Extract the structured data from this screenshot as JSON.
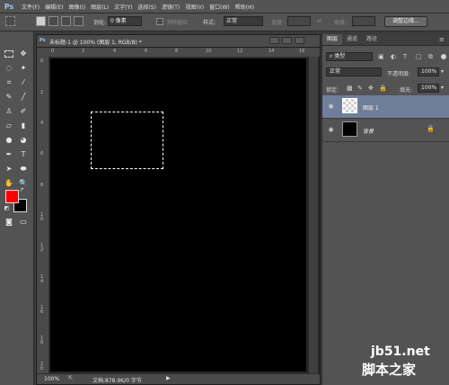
{
  "app": {
    "logo": "Ps"
  },
  "menu": [
    "文件(F)",
    "编辑(E)",
    "图像(I)",
    "图层(L)",
    "文字(Y)",
    "选择(S)",
    "滤镜(T)",
    "视图(V)",
    "窗口(W)",
    "帮助(H)"
  ],
  "options": {
    "feather_label": "羽化:",
    "feather_value": "0 像素",
    "antialias_label": "消除锯齿",
    "style_label": "样式:",
    "style_value": "正常",
    "width_label": "宽度:",
    "height_label": "高度:",
    "refine_edge_button": "调整边缘..."
  },
  "document": {
    "title": "未标题-1 @ 100% (图层 1, RGB/8) *",
    "ruler_top": [
      "0",
      "2",
      "4",
      "6",
      "8",
      "10",
      "12",
      "14",
      "16"
    ],
    "ruler_left": [
      "0",
      "2",
      "4",
      "6",
      "8",
      "1\n0",
      "1\n2",
      "1\n4",
      "1\n6",
      "1\n8",
      "2\n0"
    ],
    "zoom": "100%",
    "status_text": "文档:878.9K/0 字节"
  },
  "layers_panel": {
    "tabs": [
      "图层",
      "通道",
      "路径"
    ],
    "filter_label": "类型",
    "blend_mode": "正常",
    "opacity_label": "不透明度:",
    "opacity_value": "100%",
    "lock_label": "锁定:",
    "fill_label": "填充:",
    "fill_value": "100%",
    "layers": [
      {
        "name": "图层 1",
        "selected": true,
        "thumb": "transparent"
      },
      {
        "name": "背景",
        "selected": false,
        "thumb": "black",
        "locked": true
      }
    ]
  },
  "colors": {
    "foreground": "#ff0000",
    "background": "#000000",
    "selected_layer": "#6f7f9a",
    "accent": "#9ac8f0"
  },
  "watermark": {
    "line1": "jb51.net",
    "line2": "脚本之家"
  }
}
